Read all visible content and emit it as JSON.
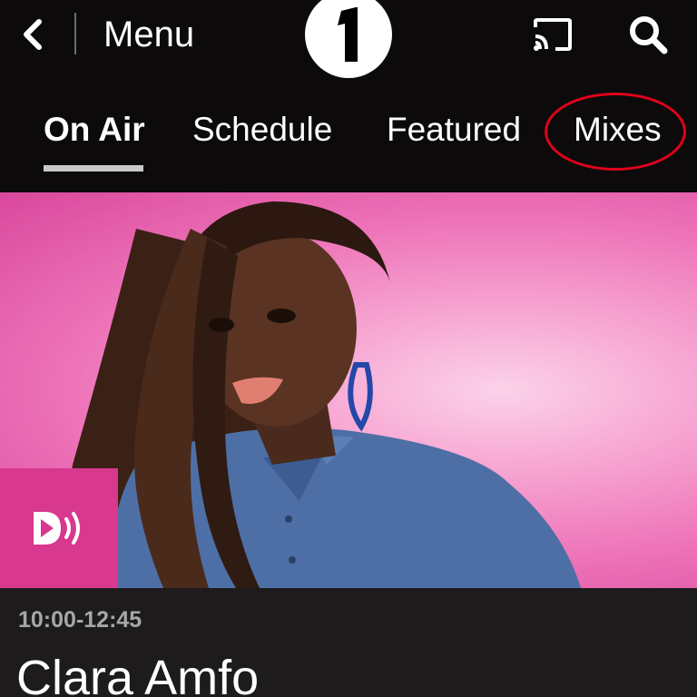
{
  "topbar": {
    "menu_label": "Menu",
    "logo_text": "1",
    "icons": {
      "back": "chevron-left-icon",
      "cast": "cast-icon",
      "search": "search-icon"
    }
  },
  "tabs": [
    {
      "label": "On Air",
      "active": true
    },
    {
      "label": "Schedule",
      "active": false
    },
    {
      "label": "Featured",
      "active": false
    },
    {
      "label": "Mixes",
      "active": false,
      "circled": true
    }
  ],
  "now_playing": {
    "time": "10:00-12:45",
    "presenter": "Clara Amfo",
    "listen_icon": "listen-live-icon"
  },
  "colors": {
    "background": "#0c0a0b",
    "accent_pink": "#d8388e",
    "annotation_red": "#e0001b",
    "info_bg": "#1d1b1c"
  }
}
